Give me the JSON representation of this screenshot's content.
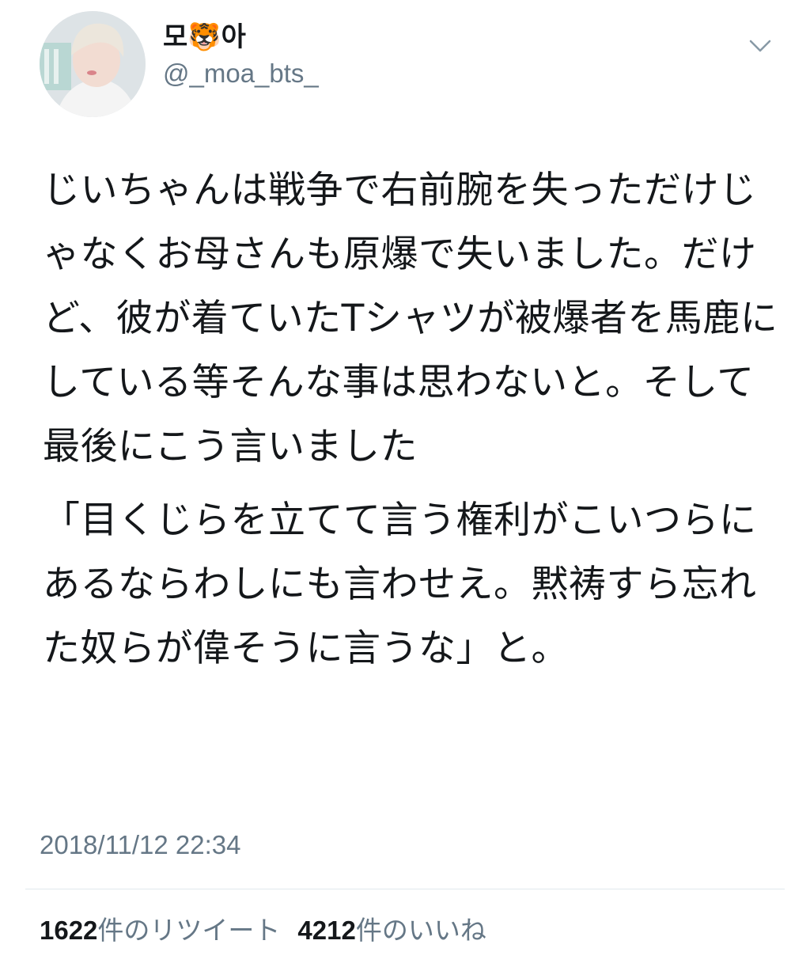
{
  "user": {
    "display_name": "모🐯아",
    "handle": "@_moa_bts_"
  },
  "tweet": {
    "paragraphs": [
      "じいちゃんは戦争で右前腕を失っただけじゃなくお母さんも原爆で失いました。だけど、彼が着ていたTシャツが被爆者を馬鹿にしている等そんな事は思わないと。そして最後にこう言いました",
      "「目くじらを立てて言う権利がこいつらにあるならわしにも言わせえ。黙祷すら忘れた奴らが偉そうに言うな」と。"
    ],
    "timestamp": "2018/11/12 22:34"
  },
  "stats": {
    "retweet_count": "1622",
    "retweet_label": "件のリツイート",
    "like_count": "4212",
    "like_label": "件のいいね"
  },
  "icons": {
    "menu": "chevron-down-icon"
  },
  "colors": {
    "text": "#14171a",
    "secondary": "#657786",
    "divider": "#e1e8ed"
  }
}
